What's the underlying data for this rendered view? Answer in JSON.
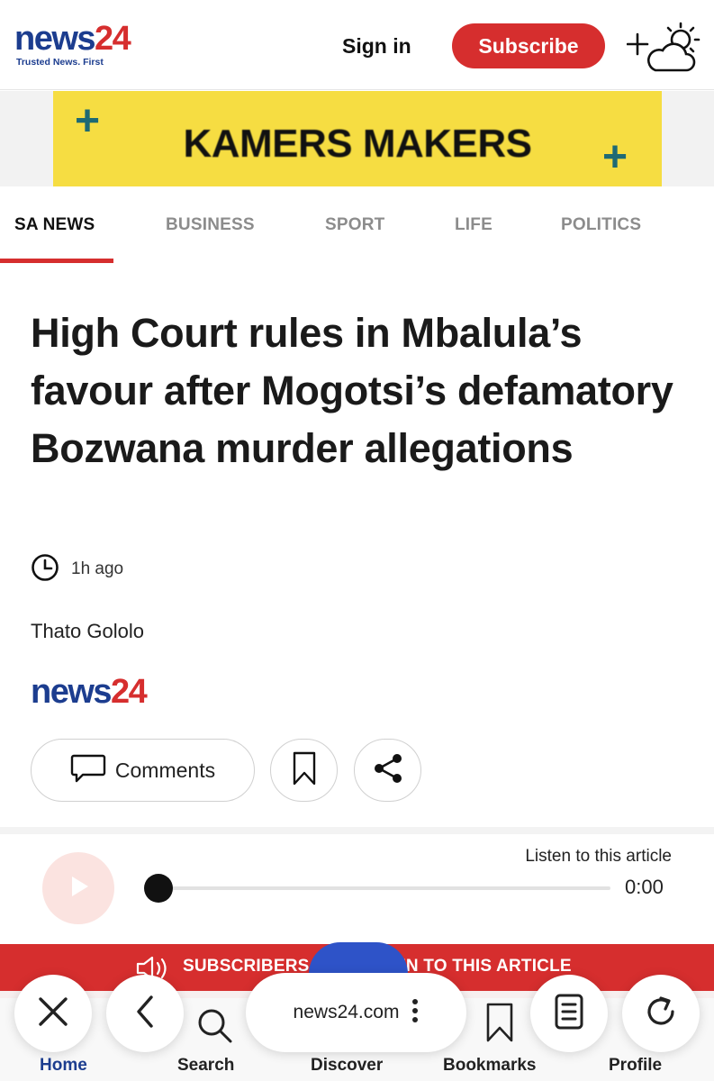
{
  "header": {
    "logo_news": "news",
    "logo_num": "24",
    "logo_tagline": "Trusted News. First",
    "signin_label": "Sign in",
    "subscribe_label": "Subscribe",
    "weather_icon": "add-weather-icon"
  },
  "ad": {
    "text": "KAMERS MAKERS",
    "plus_glyph": "+",
    "background_color": "#f6dd42"
  },
  "nav": {
    "items": [
      {
        "label": "SA NEWS",
        "active": true
      },
      {
        "label": "BUSINESS",
        "active": false
      },
      {
        "label": "SPORT",
        "active": false
      },
      {
        "label": "LIFE",
        "active": false
      },
      {
        "label": "POLITICS",
        "active": false
      }
    ]
  },
  "article": {
    "headline": "High Court rules in Mbalula’s favour after Mogotsi’s defamatory Bozwana murder allegations",
    "time_ago": "1h ago",
    "author": "Thato Gololo",
    "source_news": "news",
    "source_num": "24"
  },
  "actions": {
    "comments_label": "Comments",
    "bookmark_icon": "bookmark-icon",
    "share_icon": "share-icon"
  },
  "audio": {
    "listen_label": "Listen to this article",
    "current_time": "0:00",
    "progress": 0
  },
  "banner": {
    "text_left": "SUBSCRIBERS C",
    "text_right": "EN TO THIS ARTICLE"
  },
  "browser": {
    "url": "news24.com",
    "tab_labels": [
      "Home",
      "Search",
      "Discover",
      "Bookmarks",
      "Profile"
    ]
  },
  "colors": {
    "brand_blue": "#1c3d8f",
    "brand_red": "#d62e2e"
  }
}
